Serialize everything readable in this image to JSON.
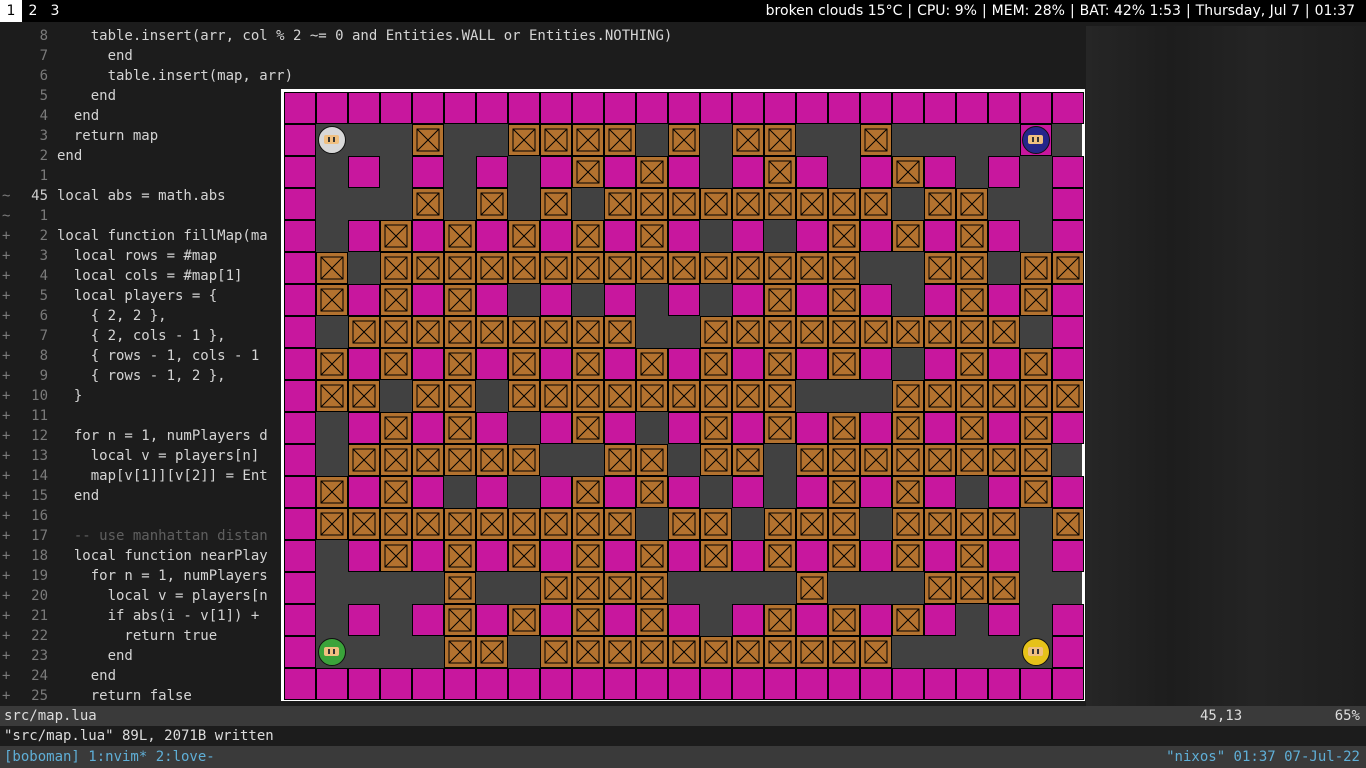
{
  "topbar": {
    "workspaces": [
      "1",
      "2",
      "3"
    ],
    "active_workspace": "1",
    "weather": "broken clouds 15°C",
    "cpu": "CPU:  9%",
    "mem": "MEM:  28%",
    "battery": "BAT: 42% 1:53",
    "date": "Thursday, Jul  7",
    "time": "01:37"
  },
  "editor": {
    "lines": [
      {
        "sign": "",
        "num": "8",
        "text": "    table.insert(arr, col % 2 ~= 0 and Entities.WALL or Entities.NOTHING)"
      },
      {
        "sign": "",
        "num": "7",
        "text": "      end"
      },
      {
        "sign": "",
        "num": "6",
        "text": "      table.insert(map, arr)"
      },
      {
        "sign": "",
        "num": "5",
        "text": "    end"
      },
      {
        "sign": "",
        "num": "4",
        "text": "  end"
      },
      {
        "sign": "",
        "num": "3",
        "text": "  return map"
      },
      {
        "sign": "",
        "num": "2",
        "text": "end"
      },
      {
        "sign": "",
        "num": "1",
        "text": ""
      },
      {
        "sign": "~",
        "num": "45",
        "text": "local abs = math.abs"
      },
      {
        "sign": "~",
        "num": "1",
        "text": ""
      },
      {
        "sign": "+",
        "num": "2",
        "text": "local function fillMap(ma"
      },
      {
        "sign": "+",
        "num": "3",
        "text": "  local rows = #map"
      },
      {
        "sign": "+",
        "num": "4",
        "text": "  local cols = #map[1]"
      },
      {
        "sign": "+",
        "num": "5",
        "text": "  local players = {"
      },
      {
        "sign": "+",
        "num": "6",
        "text": "    { 2, 2 },"
      },
      {
        "sign": "+",
        "num": "7",
        "text": "    { 2, cols - 1 },"
      },
      {
        "sign": "+",
        "num": "8",
        "text": "    { rows - 1, cols - 1"
      },
      {
        "sign": "+",
        "num": "9",
        "text": "    { rows - 1, 2 },"
      },
      {
        "sign": "+",
        "num": "10",
        "text": "  }"
      },
      {
        "sign": "+",
        "num": "11",
        "text": ""
      },
      {
        "sign": "+",
        "num": "12",
        "text": "  for n = 1, numPlayers d"
      },
      {
        "sign": "+",
        "num": "13",
        "text": "    local v = players[n]"
      },
      {
        "sign": "+",
        "num": "14",
        "text": "    map[v[1]][v[2]] = Ent"
      },
      {
        "sign": "+",
        "num": "15",
        "text": "  end"
      },
      {
        "sign": "+",
        "num": "16",
        "text": ""
      },
      {
        "sign": "+",
        "num": "17",
        "text": "  -- use manhattan distan"
      },
      {
        "sign": "+",
        "num": "18",
        "text": "  local function nearPlay"
      },
      {
        "sign": "+",
        "num": "19",
        "text": "    for n = 1, numPlayers"
      },
      {
        "sign": "+",
        "num": "20",
        "text": "      local v = players[n"
      },
      {
        "sign": "+",
        "num": "21",
        "text": "      if abs(i - v[1]) +"
      },
      {
        "sign": "+",
        "num": "22",
        "text": "        return true"
      },
      {
        "sign": "+",
        "num": "23",
        "text": "      end"
      },
      {
        "sign": "+",
        "num": "24",
        "text": "    end"
      },
      {
        "sign": "+",
        "num": "25",
        "text": "    return false"
      }
    ]
  },
  "statusline": {
    "filename": "src/map.lua",
    "position": "45,13",
    "percent": "65%"
  },
  "message": "\"src/map.lua\" 89L, 2071B written",
  "tmux": {
    "left": "[boboman] 1:nvim* 2:love-",
    "right": "\"nixos\" 01:37 07-Jul-22"
  },
  "game": {
    "legend": {
      "W": "wall",
      "C": "crate",
      ".": "floor"
    },
    "grid": [
      "WWWWWWWWWWWWWWWWWWWWWWWWW",
      "W...C..CCCC.C.CC..C....W",
      "W.W.W.W.WCWCW.WCW.WCW.W.W",
      "W...C.C.C.CCCCCCCCC.CC..W",
      "W.WCWCWCWCWCW.W.WCWCWCW.W",
      "WC.CCCCCCCCCCCCCCC..CC.CCW",
      "WCWCWCW.W.W.W.WCWCW.WCWCW",
      "W.CCCCCCCCC..CCCCCCCCCC.W",
      "WCWCWCWCWCWCWCWCWCW.WCWCW",
      "WCC.CC.CCCCCCCCC...CCCCCCW",
      "W.WCWCW.WCW.WCWCWCWCWCWCW",
      "W.CCCCCC..CC.CC.CCCCCCCC.W",
      "WCWCW.W.WCWCW.W.WCWCW.WCW",
      "WCCCCCCCCCC.CC.CCC.CCCC.CW",
      "W.WCWCWCWCWCWCWCWCWCWCW.W",
      "W....C..CCCC....C...CCC...W",
      "W.W.WCWCWCWCW.WCWCWCW.W.W",
      "W....CC.CCCCCCCCCCC.....W",
      "WWWWWWWWWWWWWWWWWWWWWWWWW"
    ],
    "players": [
      {
        "name": "player-white",
        "row": 1,
        "col": 1,
        "color": "#d8d8d8"
      },
      {
        "name": "player-blue",
        "row": 1,
        "col": 23,
        "color": "#26268a"
      },
      {
        "name": "player-green",
        "row": 17,
        "col": 1,
        "color": "#3aa33a"
      },
      {
        "name": "player-yellow",
        "row": 17,
        "col": 23,
        "color": "#e6c21a"
      }
    ]
  },
  "colors": {
    "wall": "#c8179e",
    "crate": "#b3722f",
    "floor": "#414141",
    "top_bar_bg": "#000000",
    "status_bg": "#3a3a3a",
    "tmux_text": "#5fafd7"
  }
}
